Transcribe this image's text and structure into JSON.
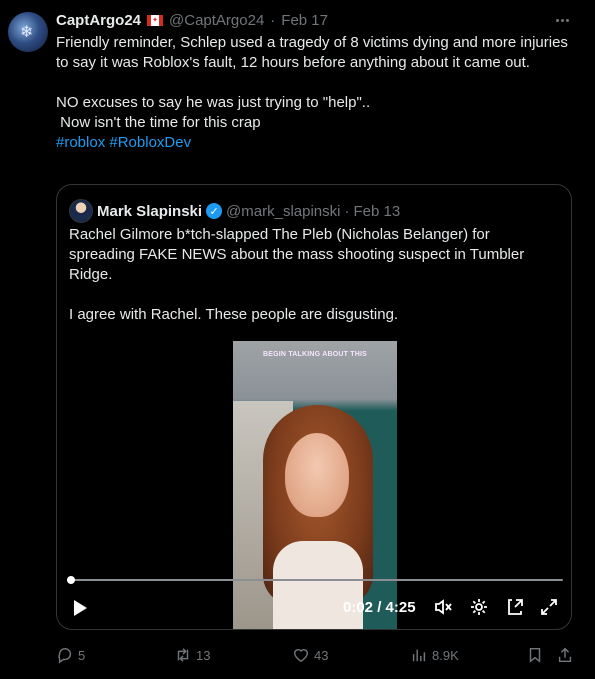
{
  "post": {
    "author_name": "CaptArgo24",
    "author_handle": "@CaptArgo24",
    "date": "Feb 17",
    "separator": "·",
    "text_lines": [
      "Friendly reminder, Schlep used a tragedy of 8 victims dying and more injuries to say it was Roblox's fault, 12 hours before anything about it came out.",
      "",
      "NO excuses to say he was just trying to \"help\"..",
      " Now isn't the time for this crap"
    ],
    "hashtags": [
      "#roblox",
      "#RobloxDev"
    ]
  },
  "quoted_post": {
    "author_name": "Mark Slapinski",
    "verified": true,
    "author_handle": "@mark_slapinski",
    "date": "Feb 13",
    "separator": "·",
    "text_lines": [
      "Rachel Gilmore b*tch-slapped The Pleb (Nicholas Belanger) for spreading FAKE NEWS about the mass shooting suspect in Tumbler Ridge.",
      "",
      "I agree with Rachel. These people are disgusting."
    ],
    "video": {
      "caption": "BEGIN TALKING ABOUT THIS",
      "current_time": "0:02",
      "duration": "4:25",
      "time_separator": " / ",
      "progress_fraction": 0.008
    }
  },
  "actions": {
    "replies": "5",
    "reposts": "13",
    "likes": "43",
    "views": "8.9K"
  },
  "colors": {
    "background": "#000000",
    "text": "#e7e9ea",
    "muted": "#71767b",
    "accent": "#1d9bf0",
    "border": "#333639"
  }
}
